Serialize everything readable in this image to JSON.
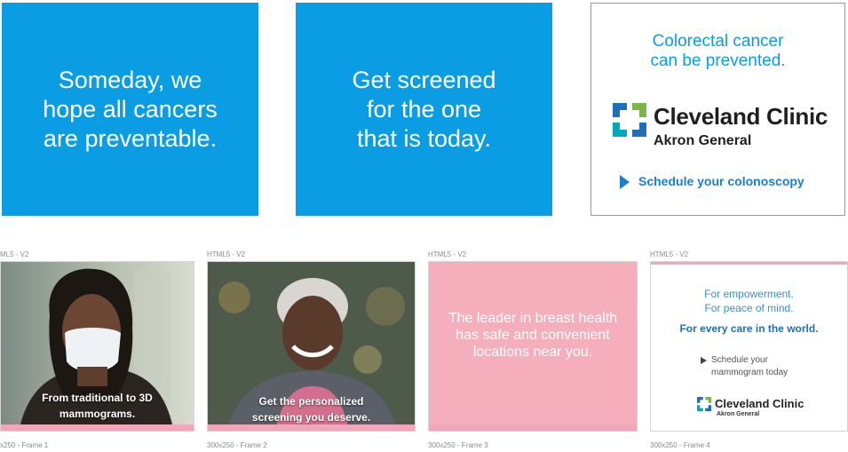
{
  "top_row": {
    "panel1_text": "Someday, we hope all cancers are preventable.",
    "panel2_text": "Get screened for the one that is today.",
    "panel3": {
      "tagline": "Colorectal cancer can be prevented.",
      "logo_name": "Cleveland Clinic",
      "logo_sub": "Akron General",
      "cta": "Schedule your colonoscopy"
    }
  },
  "bottom_row": {
    "frames": [
      {
        "label_top": "ML5 - V2",
        "label_bottom": "x250 - Frame 1",
        "text": "From traditional to 3D mammograms."
      },
      {
        "label_top": "HTML5 - V2",
        "label_bottom": "300x250 - Frame 2",
        "text": "Get the personalized screening you deserve."
      },
      {
        "label_top": "HTML5 - V2",
        "label_bottom": "300x250 - Frame 3",
        "text": "The leader in breast health has safe and convenient locations near you."
      },
      {
        "label_top": "HTML5 - V2",
        "label_bottom": "300x250 - Frame 4",
        "line1": "For empowerment.",
        "line2": "For peace of mind.",
        "line3": "For every care in the world.",
        "schedule1": "Schedule your",
        "schedule2": "mammogram today",
        "logo_name": "Cleveland Clinic",
        "logo_sub": "Akron General"
      }
    ]
  },
  "colors": {
    "brand_blue": "#0a9de3",
    "pink": "#f5aebc",
    "logo_blue": "#1f6fb8",
    "logo_green": "#7ab648",
    "logo_teal": "#00a9b7"
  }
}
